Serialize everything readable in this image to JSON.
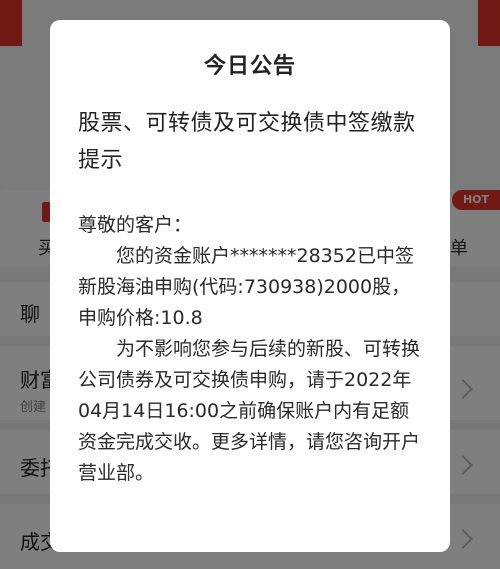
{
  "background": {
    "quick_left_label": "买",
    "hot_badge": "HOT",
    "quick_right_label": "单",
    "rows": [
      {
        "label": "聊"
      },
      {
        "label": "财富",
        "sub": "创建"
      },
      {
        "label": "委托"
      },
      {
        "label": "成交"
      }
    ]
  },
  "modal": {
    "title": "今日公告",
    "heading": "股票、可转债及可交换债中签缴款提示",
    "greeting": "尊敬的客户：",
    "paragraph1": "您的资金账户*******28352已中签新股海油申购(代码:730938)2000股，申购价格:10.8",
    "paragraph2": "为不影响您参与后续的新股、可转换公司债券及可交换债申购，请于2022年04月14日16:00之前确保账户内有足额资金完成交收。更多详情，请您咨询开户营业部。"
  },
  "colors": {
    "accent_red": "#e2342b",
    "overlay": "rgba(0,0,0,0.5)"
  }
}
